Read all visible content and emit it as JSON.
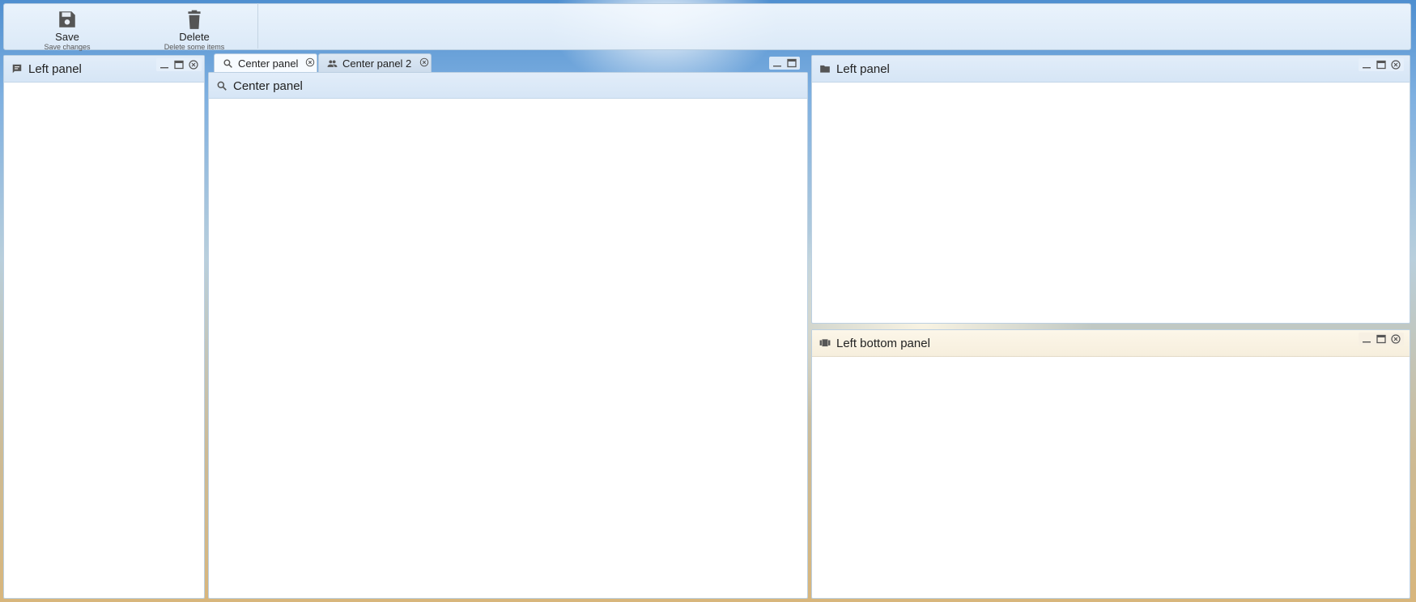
{
  "toolbar": {
    "save": {
      "label": "Save",
      "sublabel": "Save changes",
      "icon": "floppy-disk-icon"
    },
    "delete": {
      "label": "Delete",
      "sublabel": "Delete some items",
      "icon": "trash-icon"
    }
  },
  "left_panel": {
    "title": "Left panel",
    "icon": "chat-bubble-icon"
  },
  "center": {
    "tabs": [
      {
        "label": "Center panel",
        "icon": "search-icon",
        "active": true
      },
      {
        "label": "Center panel 2",
        "icon": "people-icon",
        "active": false
      }
    ],
    "panel_title": "Center panel",
    "panel_icon": "search-icon"
  },
  "right_top_panel": {
    "title": "Left panel",
    "icon": "folder-icon"
  },
  "right_bottom_panel": {
    "title": "Left bottom panel",
    "icon": "view-carousel-icon"
  }
}
